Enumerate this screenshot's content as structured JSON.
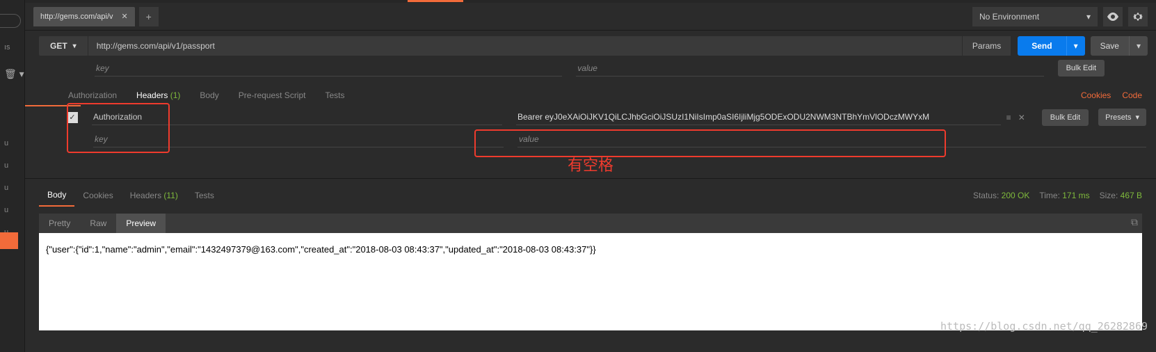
{
  "leftsidebar": {
    "text_partial": "ıs",
    "u_items": [
      "u",
      "u",
      "u",
      "u",
      "u"
    ]
  },
  "tabs": {
    "active": "http://gems.com/api/v"
  },
  "environment": {
    "label": "No Environment"
  },
  "request": {
    "method": "GET",
    "url": "http://gems.com/api/v1/passport",
    "params_label": "Params",
    "send_label": "Send",
    "save_label": "Save",
    "kv_placeholder_key": "key",
    "kv_placeholder_value": "value",
    "bulkedit_label": "Bulk Edit",
    "tabs": {
      "authorization": "Authorization",
      "headers": "Headers",
      "headers_count": "(1)",
      "body": "Body",
      "prerequest": "Pre-request Script",
      "tests": "Tests"
    },
    "links": {
      "cookies": "Cookies",
      "code": "Code"
    },
    "header_row": {
      "key": "Authorization",
      "value": "Bearer eyJ0eXAiOiJKV1QiLCJhbGciOiJSUzI1NiIsImp0aSI6IjliMjg5ODExODU2NWM3NTBhYmVlODczMWYxM"
    },
    "presets_label": "Presets"
  },
  "annotation": "有空格",
  "response": {
    "tabs": {
      "body": "Body",
      "cookies": "Cookies",
      "headers": "Headers",
      "headers_count": "(11)",
      "tests": "Tests"
    },
    "status_label": "Status:",
    "status_value": "200 OK",
    "time_label": "Time:",
    "time_value": "171 ms",
    "size_label": "Size:",
    "size_value": "467 B",
    "viewtabs": {
      "pretty": "Pretty",
      "raw": "Raw",
      "preview": "Preview"
    },
    "body_text": "{\"user\":{\"id\":1,\"name\":\"admin\",\"email\":\"1432497379@163.com\",\"created_at\":\"2018-08-03 08:43:37\",\"updated_at\":\"2018-08-03 08:43:37\"}}"
  },
  "watermark": "https://blog.csdn.net/qq_26282869"
}
